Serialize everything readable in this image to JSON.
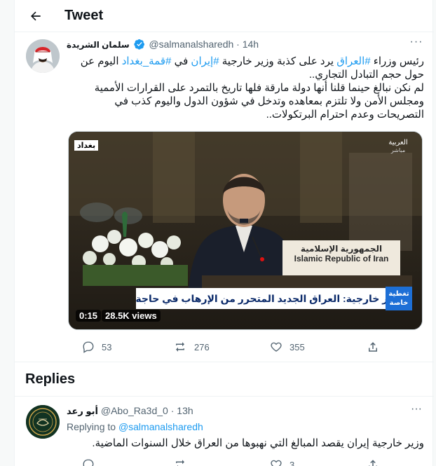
{
  "header": {
    "title": "Tweet"
  },
  "tweet": {
    "author_name": "سلمان الشريدة",
    "handle": "@salmanalsharedh",
    "time": "14h",
    "text_lines": [
      [
        "رئيس وزراء ",
        "#العراق",
        " يرد على كذبة وزير خارجية ",
        "#إيران",
        " في ",
        "#قمة_بغداد",
        " اليوم عن"
      ],
      [
        "حول حجم التبادل التجاري.."
      ],
      [
        "لم نكن نبالغ حينما قلنا أنها دولة مارقة فلها تاريخ بالتمرد على القرارات الأممية"
      ],
      [
        "ومجلس الأمن ولا تلتزم بمعاهده وتدخل في شؤون الدول واليوم كذب في"
      ],
      [
        "التصريحات وعدم احترام البرتكولات.."
      ]
    ],
    "hashtags": [
      "#العراق",
      "#إيران",
      "#قمة_بغداد"
    ],
    "video": {
      "location_tag": "بغداد",
      "channel_logo": "العربية",
      "channel_sub": "مباشر",
      "ticker_text": "وزير خارجية: العراق الجديد المتحرر من الإرهاب في حاجة إلى إعادة الإعمار",
      "badge_text": "تغطية خاصة",
      "podium_sign": "Islamic Republic of Iran",
      "podium_sign_ar": "الجمهورية الإسلامية",
      "time": "0:15",
      "views": "28.5K views"
    },
    "stats": {
      "replies": "53",
      "retweets": "276",
      "likes": "355"
    }
  },
  "replies_section": {
    "title": "Replies"
  },
  "reply": {
    "author_name": "أبو رعد",
    "handle": "@Abo_Ra3d_0",
    "time": "13h",
    "replying_label": "Replying to",
    "replying_to": "@salmanalsharedh",
    "text": "وزير خارجية إيران يقصد المبالغ التي نهبوها من العراق خلال السنوات الماضية.",
    "stats": {
      "likes": "3"
    }
  },
  "colors": {
    "accent": "#1d9bf0",
    "muted": "#536471",
    "border": "#eff3f4",
    "verified": "#1d9bf0"
  }
}
